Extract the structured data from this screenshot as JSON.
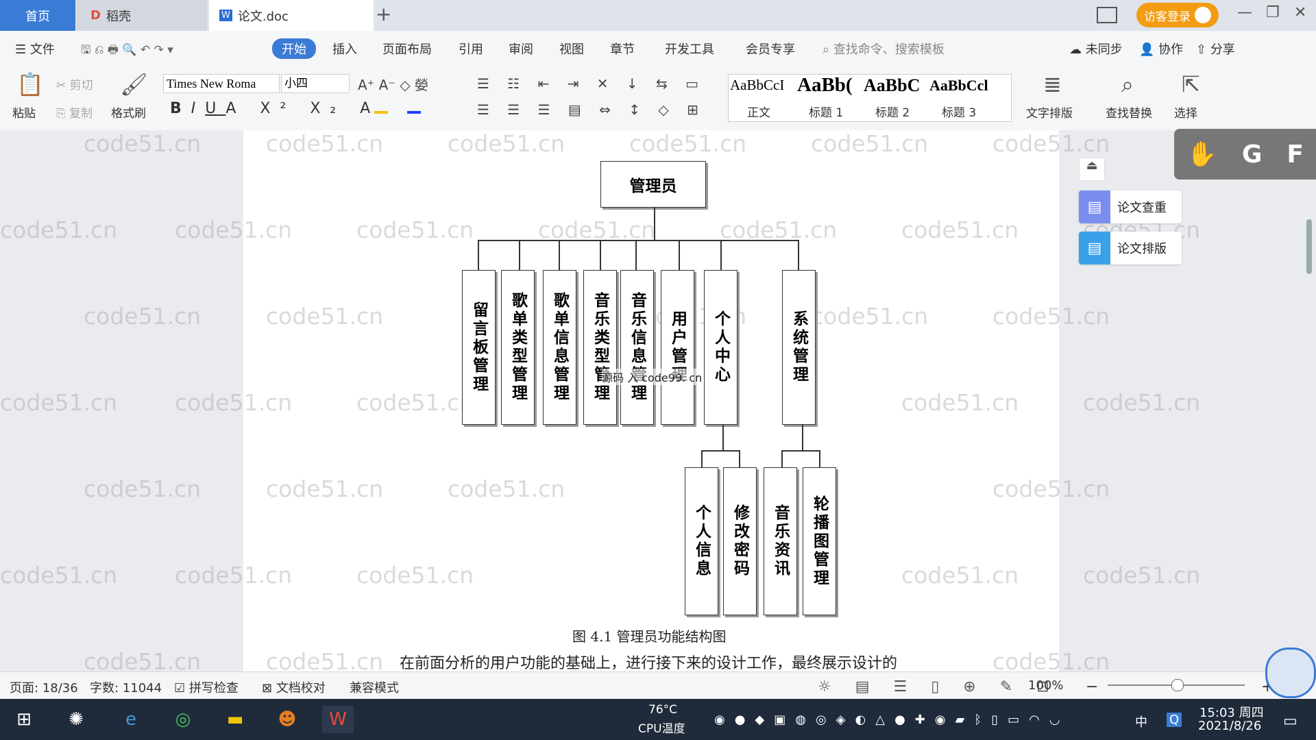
{
  "tabs": {
    "home": "首页",
    "daoke": "稻壳",
    "doc": "论文.doc",
    "new_tab": "+"
  },
  "header": {
    "login": "访客登录"
  },
  "menu": [
    "文件",
    "开始",
    "插入",
    "页面布局",
    "引用",
    "审阅",
    "视图",
    "章节",
    "开发工具",
    "会员专享"
  ],
  "search_cmd": "查找命令、搜索模板",
  "top_right": {
    "sync": "未同步",
    "collab": "协作",
    "share": "分享"
  },
  "ribbon": {
    "paste": "粘贴",
    "cut": "剪切",
    "copy": "复制",
    "format_painter": "格式刷",
    "font": "Times New Roma",
    "size": "小四",
    "styles": [
      {
        "sample": "AaBbCcI",
        "label": "正文"
      },
      {
        "sample": "AaBb(",
        "label": "标题 1"
      },
      {
        "sample": "AaBbC",
        "label": "标题 2"
      },
      {
        "sample": "AaBbCcl",
        "label": "标题 3"
      }
    ],
    "text_layout": "文字排版",
    "find_replace": "查找替换",
    "select": "选择"
  },
  "diagram": {
    "root": "管理员",
    "level1": [
      "留言板管理",
      "歌单类型管理",
      "歌单信息管理",
      "音乐类型管理",
      "音乐信息管理",
      "用户管理",
      "个人中心",
      "系统管理"
    ],
    "level2_personal": [
      "个人信息",
      "修改密码"
    ],
    "level2_system": [
      "音乐资讯",
      "轮播图管理"
    ],
    "overlay": "源码 入 code99. cn",
    "caption": "图 4.1  管理员功能结构图"
  },
  "paragraph": "在前面分析的用户功能的基础上，进行接下来的设计工作，最终展示设计的",
  "watermark": "code51.cn",
  "side_panel": {
    "plagiarism": "论文查重",
    "layout": "论文排版"
  },
  "floatbar": [
    "G",
    "F"
  ],
  "status": {
    "page": "页面: 18/36",
    "words": "字数: 11044",
    "spell": "拼写检查",
    "proof": "文档校对",
    "compat": "兼容模式",
    "zoom": "100%"
  },
  "taskbar": {
    "temp": "76°C",
    "cpu": "CPU温度",
    "ime": "中",
    "time": "15:03 周四",
    "date": "2021/8/26"
  }
}
